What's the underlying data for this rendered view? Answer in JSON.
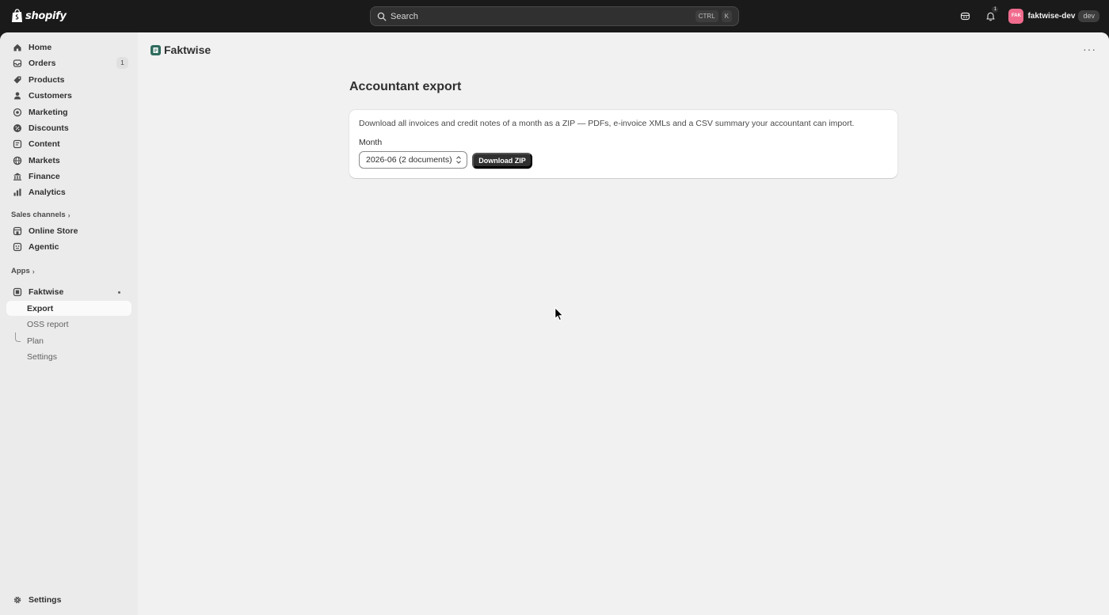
{
  "topbar": {
    "brand": "shopify",
    "search_placeholder": "Search",
    "shortcut_keys": [
      "CTRL",
      "K"
    ],
    "notification_count": "1",
    "avatar_initials": "FAK",
    "store_name": "faktwise-dev",
    "env_badge": "dev",
    "avatar_color": "#f06b8d"
  },
  "sidebar": {
    "items": [
      {
        "label": "Home",
        "icon": "home-icon"
      },
      {
        "label": "Orders",
        "icon": "inbox-icon",
        "count": "1"
      },
      {
        "label": "Products",
        "icon": "tag-icon"
      },
      {
        "label": "Customers",
        "icon": "person-icon"
      },
      {
        "label": "Marketing",
        "icon": "target-icon"
      },
      {
        "label": "Discounts",
        "icon": "discount-icon"
      },
      {
        "label": "Content",
        "icon": "content-icon"
      },
      {
        "label": "Markets",
        "icon": "globe-icon"
      },
      {
        "label": "Finance",
        "icon": "bank-icon"
      },
      {
        "label": "Analytics",
        "icon": "chart-icon"
      }
    ],
    "sales_channels_label": "Sales channels",
    "channels": [
      {
        "label": "Online Store",
        "icon": "store-icon"
      },
      {
        "label": "Agentic",
        "icon": "agentic-icon"
      }
    ],
    "apps_label": "Apps",
    "app": {
      "label": "Faktwise",
      "icon": "faktwise-app-icon"
    },
    "app_subitems": [
      {
        "label": "Export",
        "active": true
      },
      {
        "label": "OSS report",
        "active": false
      },
      {
        "label": "Plan",
        "active": false
      },
      {
        "label": "Settings",
        "active": false
      }
    ],
    "footer_settings": "Settings"
  },
  "main": {
    "app_title": "Faktwise",
    "more_label": "···",
    "page_title": "Accountant export",
    "card": {
      "description": "Download all invoices and credit notes of a month as a ZIP — PDFs, e-invoice XMLs and a CSV summary your accountant can import.",
      "month_label": "Month",
      "month_value": "2026-06 (2 documents)",
      "download_button": "Download ZIP"
    }
  },
  "colors": {
    "topbar_bg": "#1a1a1a",
    "sidebar_bg": "#ebebeb",
    "main_bg": "#f1f1f1",
    "primary_button": "#303030",
    "app_logo": "#2e6b5e"
  }
}
